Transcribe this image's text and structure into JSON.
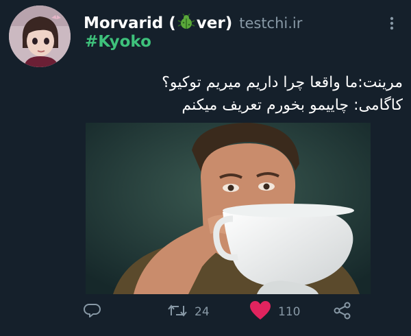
{
  "tweet": {
    "author_name_prefix": "Morvarid (",
    "author_name_suffix": "ver)",
    "handle": "testchi.ir",
    "hashtag": "#Kyoko",
    "text_lines": [
      "مرینت:ما واقعا چرا داریم میریم توکیو؟",
      "کاگامی: چاییمو بخورم تعریف میکنم"
    ]
  },
  "actions": {
    "retweet_count": "24",
    "like_count": "110"
  },
  "icons": {
    "more": "more-vertical-icon",
    "reply": "reply-icon",
    "retweet": "retweet-icon",
    "like": "heart-icon",
    "share": "share-icon",
    "author_emoji": "bug-icon"
  },
  "colors": {
    "background": "#15202b",
    "hashtag": "#3ec17b",
    "secondary_text": "#8899a6",
    "like_active": "#e0245e"
  }
}
